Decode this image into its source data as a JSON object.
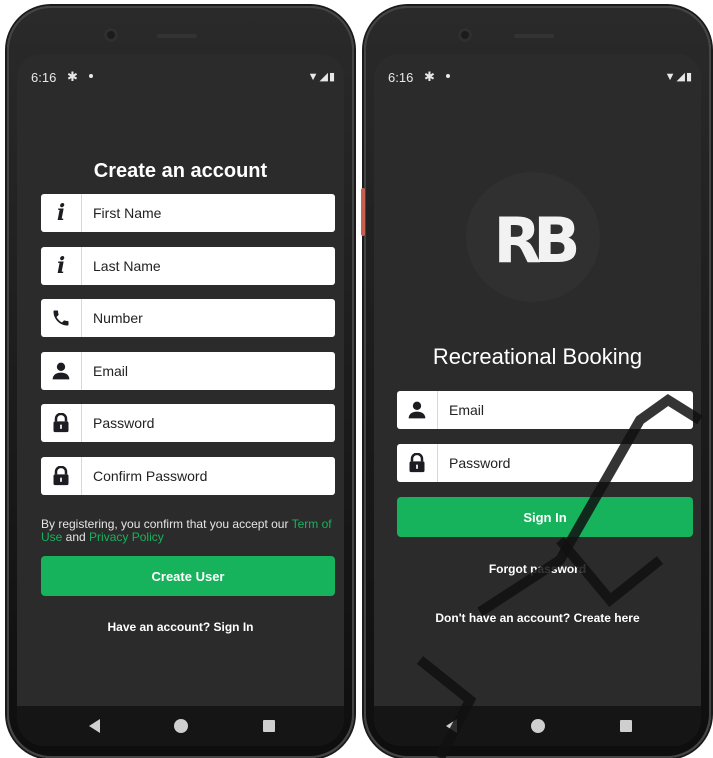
{
  "signup": {
    "status_time": "6:16",
    "title": "Create an account",
    "fields": [
      {
        "label": "First Name"
      },
      {
        "label": "Last Name"
      },
      {
        "label": "Number"
      },
      {
        "label": "Email"
      },
      {
        "label": "Password"
      },
      {
        "label": "Confirm Password"
      }
    ],
    "terms_prefix": "By registering, you confirm that you accept our ",
    "terms_link": "Term of Use",
    "terms_and": " and ",
    "privacy_link": "Privacy Policy",
    "create_button": "Create User",
    "sign_in_prompt": "Have an account? Sign In"
  },
  "login": {
    "status_time": "6:16",
    "logo": "RB",
    "app_name": "Recreational Booking",
    "fields": [
      {
        "label": "Email"
      },
      {
        "label": "Password"
      }
    ],
    "sign_in_button": "Sign In",
    "forgot_password": "Forgot password",
    "create_prompt": "Don't have an account? Create here"
  },
  "colors": {
    "accent": "#16b35c",
    "screen_bg": "#2b2b2b",
    "field_bg": "#ffffff"
  },
  "icons": {
    "first_name": "info-icon",
    "last_name": "info-icon",
    "number": "phone-icon",
    "email": "user-icon",
    "password": "lock-icon",
    "confirm_password": "lock-icon"
  }
}
